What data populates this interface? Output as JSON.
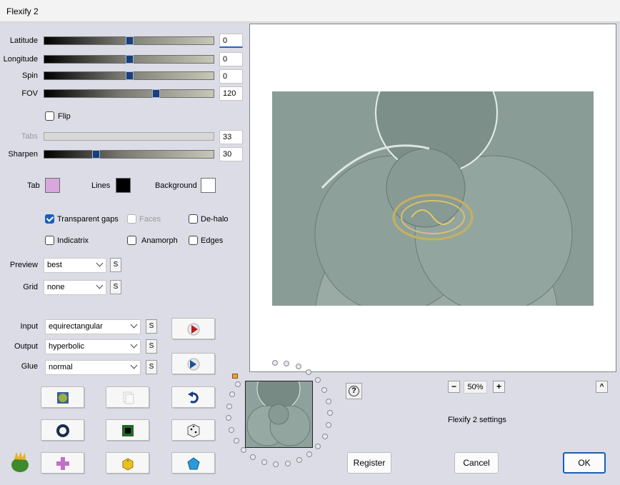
{
  "window": {
    "title": "Flexify 2"
  },
  "sliders": [
    {
      "label": "Latitude",
      "value": "0",
      "position": 0.5
    },
    {
      "label": "Longitude",
      "value": "0",
      "position": 0.5
    },
    {
      "label": "Spin",
      "value": "0",
      "position": 0.5
    },
    {
      "label": "FOV",
      "value": "120",
      "position": 0.65
    }
  ],
  "flip": {
    "label": "Flip",
    "checked": false
  },
  "tabs_slider": {
    "label": "Tabs",
    "value": "33",
    "disabled": true
  },
  "sharpen_slider": {
    "label": "Sharpen",
    "value": "30",
    "position": 0.3
  },
  "colors": {
    "tab": {
      "label": "Tab",
      "color": "#d8a8dc"
    },
    "lines": {
      "label": "Lines",
      "color": "#000000"
    },
    "background": {
      "label": "Background",
      "color": "#ffffff"
    }
  },
  "checkboxes": {
    "transparent_gaps": {
      "label": "Transparent gaps",
      "checked": true
    },
    "faces": {
      "label": "Faces",
      "checked": false,
      "disabled": true
    },
    "de_halo": {
      "label": "De-halo",
      "checked": false
    },
    "indicatrix": {
      "label": "Indicatrix",
      "checked": false
    },
    "anamorph": {
      "label": "Anamorph",
      "checked": false
    },
    "edges": {
      "label": "Edges",
      "checked": false
    }
  },
  "preview": {
    "label": "Preview",
    "value": "best",
    "s_label": "S"
  },
  "grid": {
    "label": "Grid",
    "value": "none",
    "s_label": "S"
  },
  "projection": {
    "input": {
      "label": "Input",
      "value": "equirectangular",
      "s_label": "S"
    },
    "output": {
      "label": "Output",
      "value": "hyperbolic",
      "s_label": "S"
    },
    "glue": {
      "label": "Glue",
      "value": "normal",
      "s_label": "S"
    }
  },
  "zoom": {
    "minus": "−",
    "value": "50%",
    "plus": "+"
  },
  "collapse_label": "^",
  "help_label": "?",
  "settings_caption": "Flexify 2 settings",
  "buttons": {
    "register": "Register",
    "cancel": "Cancel",
    "ok": "OK"
  },
  "accent_color": "#1a5fb4"
}
